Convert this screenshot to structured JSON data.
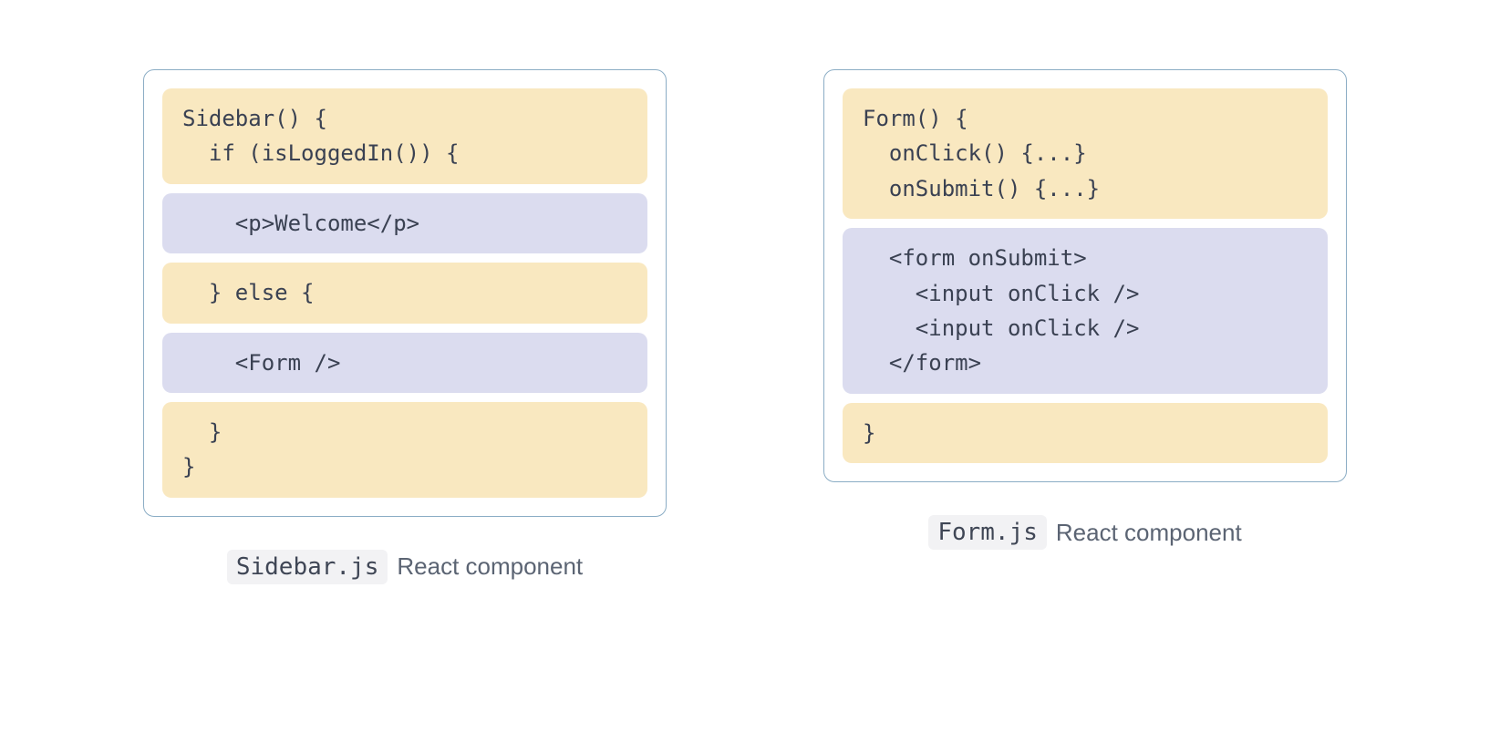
{
  "colors": {
    "panel_border": "#8badc5",
    "yellow_block": "#f9e8c0",
    "purple_block": "#dbdcef",
    "text": "#3a4152",
    "caption_text": "#5b6473",
    "filename_bg": "#f2f2f4"
  },
  "panels": [
    {
      "id": "sidebar",
      "caption_filename": "Sidebar.js",
      "caption_suffix": "React component",
      "blocks": [
        {
          "kind": "yellow",
          "text": "Sidebar() {\n  if (isLoggedIn()) {"
        },
        {
          "kind": "purple",
          "text": "    <p>Welcome</p>"
        },
        {
          "kind": "yellow",
          "text": "  } else {"
        },
        {
          "kind": "purple",
          "text": "    <Form />"
        },
        {
          "kind": "yellow",
          "text": "  }\n}"
        }
      ]
    },
    {
      "id": "form",
      "caption_filename": "Form.js",
      "caption_suffix": "React component",
      "blocks": [
        {
          "kind": "yellow",
          "text": "Form() {\n  onClick() {...}\n  onSubmit() {...}"
        },
        {
          "kind": "purple",
          "text": "  <form onSubmit>\n    <input onClick />\n    <input onClick />\n  </form>"
        },
        {
          "kind": "yellow",
          "text": "}"
        }
      ]
    }
  ]
}
